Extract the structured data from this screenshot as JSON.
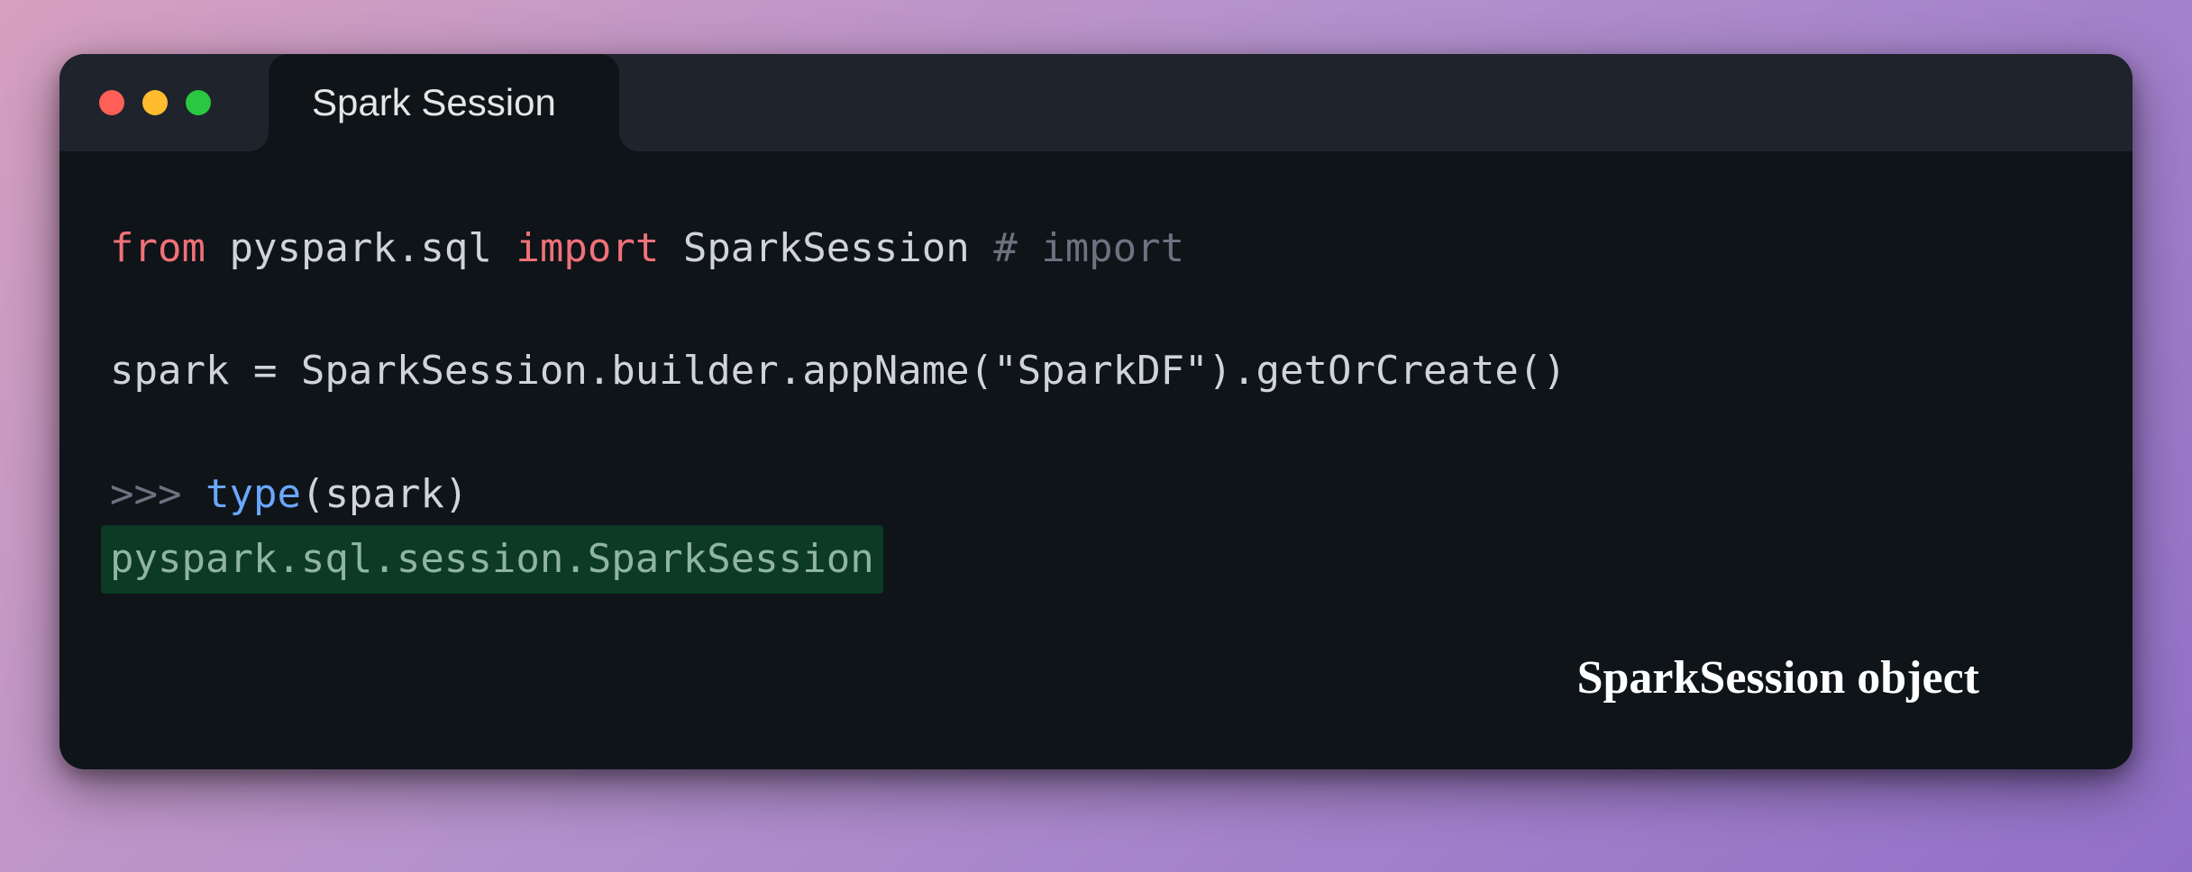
{
  "window": {
    "tab_title": "Spark Session"
  },
  "code": {
    "line1": {
      "from": "from",
      "module": "pyspark.sql",
      "import": "import",
      "target": "SparkSession",
      "comment": "# import"
    },
    "line3": {
      "assign": "spark = SparkSession.builder.appName(\"SparkDF\").getOrCreate()"
    },
    "line5": {
      "prompt": ">>>",
      "call_fn": "type",
      "call_rest": "(spark)"
    },
    "line6": {
      "output": "pyspark.sql.session.SparkSession"
    }
  },
  "annotation": "SparkSession object"
}
